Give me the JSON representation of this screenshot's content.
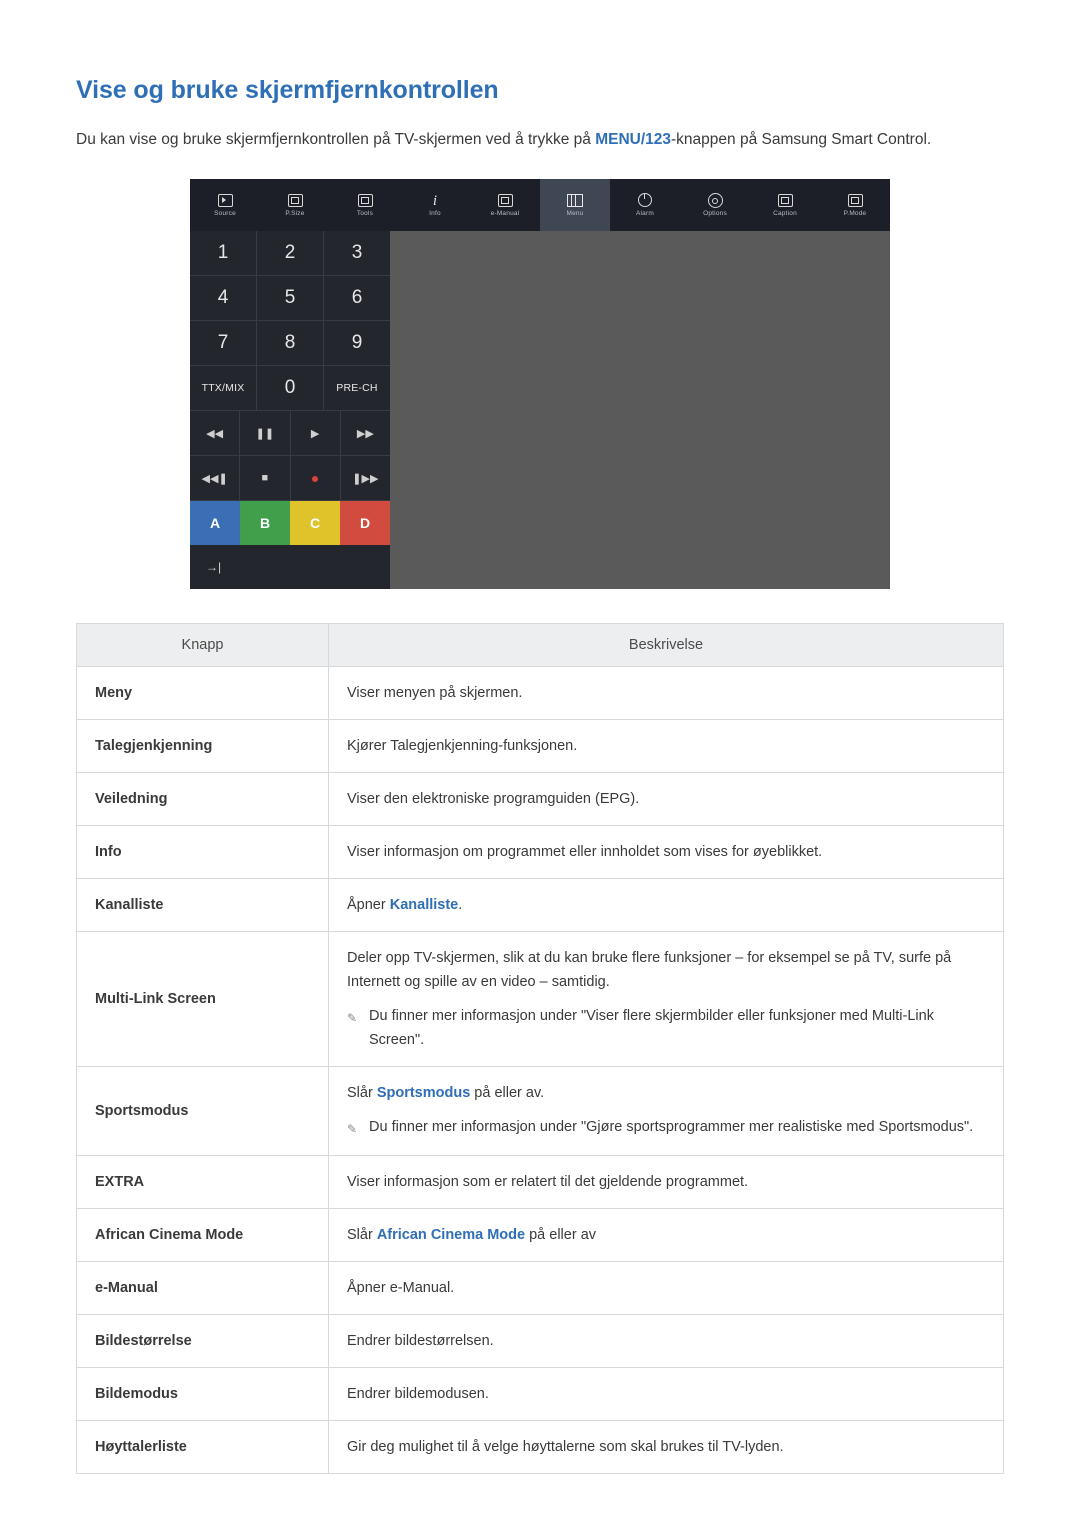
{
  "page": {
    "title": "Vise og bruke skjermfjernkontrollen",
    "intro_part1": "Du kan vise og bruke skjermfjernkontrollen på TV-skjermen ved å trykke på ",
    "intro_keyword": "MENU/123",
    "intro_part2": "-knappen på Samsung Smart Control."
  },
  "remote": {
    "topbar": [
      {
        "label": "Source",
        "icon": "source-icon"
      },
      {
        "label": "P.Size",
        "icon": "picture-size-icon"
      },
      {
        "label": "Tools",
        "icon": "tools-icon"
      },
      {
        "label": "Info",
        "icon": "info-icon"
      },
      {
        "label": "e-Manual",
        "icon": "e-manual-icon"
      },
      {
        "label": "Menu",
        "icon": "menu-icon"
      },
      {
        "label": "Alarm",
        "icon": "alarm-icon"
      },
      {
        "label": "Options",
        "icon": "options-icon"
      },
      {
        "label": "Caption",
        "icon": "caption-icon"
      },
      {
        "label": "P.Mode",
        "icon": "picture-mode-icon"
      }
    ],
    "active_index": 5,
    "numpad": [
      [
        "1",
        "2",
        "3"
      ],
      [
        "4",
        "5",
        "6"
      ],
      [
        "7",
        "8",
        "9"
      ],
      [
        "TTX/MIX",
        "0",
        "PRE-CH"
      ]
    ],
    "transport_row1": [
      "◀◀",
      "❚❚",
      "▶",
      "▶▶"
    ],
    "transport_row2": [
      "◀◀❚",
      "■",
      "●",
      "❚▶▶"
    ],
    "color_buttons": [
      "A",
      "B",
      "C",
      "D"
    ],
    "exit_label": "→|"
  },
  "table": {
    "headers": [
      "Knapp",
      "Beskrivelse"
    ],
    "rows": [
      {
        "button": "Meny",
        "desc": "Viser menyen på skjermen."
      },
      {
        "button": "Talegjenkjenning",
        "desc": "Kjører Talegjenkjenning-funksjonen."
      },
      {
        "button": "Veiledning",
        "desc": "Viser den elektroniske programguiden (EPG)."
      },
      {
        "button": "Info",
        "desc": "Viser informasjon om programmet eller innholdet som vises for øyeblikket."
      },
      {
        "button": "Kanalliste",
        "desc_pre": "Åpner ",
        "desc_kw": "Kanalliste",
        "desc_post": "."
      },
      {
        "button": "Multi-Link Screen",
        "desc": "Deler opp TV-skjermen, slik at du kan bruke flere funksjoner – for eksempel se på TV, surfe på Internett og spille av en video – samtidig.",
        "note": "Du finner mer informasjon under \"Viser flere skjermbilder eller funksjoner med Multi-Link Screen\"."
      },
      {
        "button": "Sportsmodus",
        "desc_pre": "Slår ",
        "desc_kw": "Sportsmodus",
        "desc_post": " på eller av.",
        "note": "Du finner mer informasjon under \"Gjøre sportsprogrammer mer realistiske med Sportsmodus\"."
      },
      {
        "button": "EXTRA",
        "desc": "Viser informasjon som er relatert til det gjeldende programmet."
      },
      {
        "button": "African Cinema Mode",
        "desc_pre": "Slår ",
        "desc_kw": "African Cinema Mode",
        "desc_post": " på eller av"
      },
      {
        "button": "e-Manual",
        "desc": "Åpner e-Manual."
      },
      {
        "button": "Bildestørrelse",
        "desc": "Endrer bildestørrelsen."
      },
      {
        "button": "Bildemodus",
        "desc": "Endrer bildemodusen."
      },
      {
        "button": "Høyttalerliste",
        "desc": "Gir deg mulighet til å velge høyttalerne som skal brukes til TV-lyden."
      }
    ]
  }
}
